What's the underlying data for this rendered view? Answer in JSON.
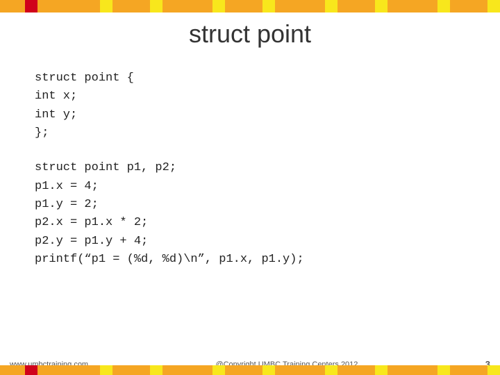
{
  "topBar": {
    "colors": [
      "#F5A623",
      "#F5A623",
      "#D0021B",
      "#F5A623",
      "#F5A623",
      "#F5A623",
      "#F5A623",
      "#F5A623",
      "#F8E71C",
      "#F5A623",
      "#F5A623",
      "#F5A623",
      "#F8E71C",
      "#F5A623",
      "#F5A623",
      "#F5A623",
      "#F5A623",
      "#F8E71C",
      "#F5A623",
      "#F5A623",
      "#F5A623",
      "#F8E71C",
      "#F5A623",
      "#F5A623",
      "#F5A623",
      "#F5A623",
      "#F8E71C",
      "#F5A623",
      "#F5A623",
      "#F5A623",
      "#F8E71C",
      "#F5A623",
      "#F5A623",
      "#F5A623",
      "#F5A623",
      "#F8E71C",
      "#F5A623",
      "#F5A623",
      "#F5A623",
      "#F8E71C"
    ]
  },
  "title": "struct point",
  "code": {
    "block1": [
      "struct point {",
      "     int x;",
      "     int y;",
      "};"
    ],
    "block2": [
      "struct point p1, p2;",
      "p1.x = 4;",
      "p1.y = 2;",
      "p2.x = p1.x * 2;",
      "p2.y = p1.y + 4;",
      "printf(“p1 = (%d, %d)\\n”, p1.x, p1.y);"
    ]
  },
  "footer": {
    "website": "www.umbctraining.com",
    "copyright": "@Copyright UMBC Training Centers 2012",
    "page": "3"
  }
}
